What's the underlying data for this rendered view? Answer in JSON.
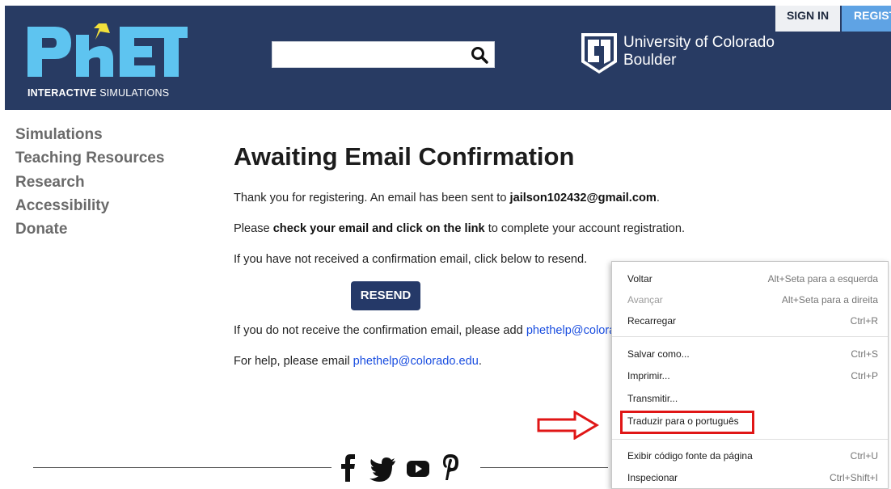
{
  "header": {
    "logo_tagline_bold": "INTERACTIVE",
    "logo_tagline_rest": " SIMULATIONS",
    "search": {
      "value": "",
      "placeholder": ""
    },
    "university": {
      "line1": "University of Colorado",
      "line2": "Boulder"
    },
    "sign_in_label": "SIGN IN",
    "register_label": "REGISTER"
  },
  "sidebar": {
    "items": [
      {
        "label": "Simulations"
      },
      {
        "label": "Teaching Resources"
      },
      {
        "label": "Research"
      },
      {
        "label": "Accessibility"
      },
      {
        "label": "Donate"
      }
    ]
  },
  "main": {
    "title": "Awaiting Email Confirmation",
    "thanks_text": "Thank you for registering. An email has been sent to ",
    "email": "jailson102432@gmail.com",
    "thanks_end": ".",
    "check_pre": "Please ",
    "check_bold": "check your email and click on the link",
    "check_post": " to complete your account registration.",
    "not_received": "If you have not received a confirmation email, click below to resend.",
    "resend_label": "RESEND",
    "add_text": "If you do not receive the confirmation email, please add ",
    "add_link": "phethelp@colorado.edu",
    "help_text": "For help, please email ",
    "help_link": "phethelp@colorado.edu",
    "help_end": "."
  },
  "footer": {
    "icons": [
      "facebook-icon",
      "twitter-icon",
      "youtube-icon",
      "pinterest-icon"
    ]
  },
  "context_menu": {
    "items": [
      {
        "label": "Voltar",
        "shortcut": "Alt+Seta para a esquerda",
        "disabled": false
      },
      {
        "label": "Avançar",
        "shortcut": "Alt+Seta para a direita",
        "disabled": true
      },
      {
        "label": "Recarregar",
        "shortcut": "Ctrl+R",
        "disabled": false
      },
      {
        "label": "Salvar como...",
        "shortcut": "Ctrl+S",
        "disabled": false
      },
      {
        "label": "Imprimir...",
        "shortcut": "Ctrl+P",
        "disabled": false
      },
      {
        "label": "Transmitir...",
        "shortcut": "",
        "disabled": false
      },
      {
        "label": "Traduzir para o português",
        "shortcut": "",
        "disabled": false
      },
      {
        "label": "Exibir código fonte da página",
        "shortcut": "Ctrl+U",
        "disabled": false
      },
      {
        "label": "Inspecionar",
        "shortcut": "Ctrl+Shift+I",
        "disabled": false
      }
    ]
  },
  "colors": {
    "header_bg": "#283b63",
    "logo_blue": "#5ec4f0",
    "logo_yellow": "#f2e03b",
    "resend_bg": "#253968",
    "link": "#1a4ee0",
    "annotation_red": "#e01616"
  }
}
